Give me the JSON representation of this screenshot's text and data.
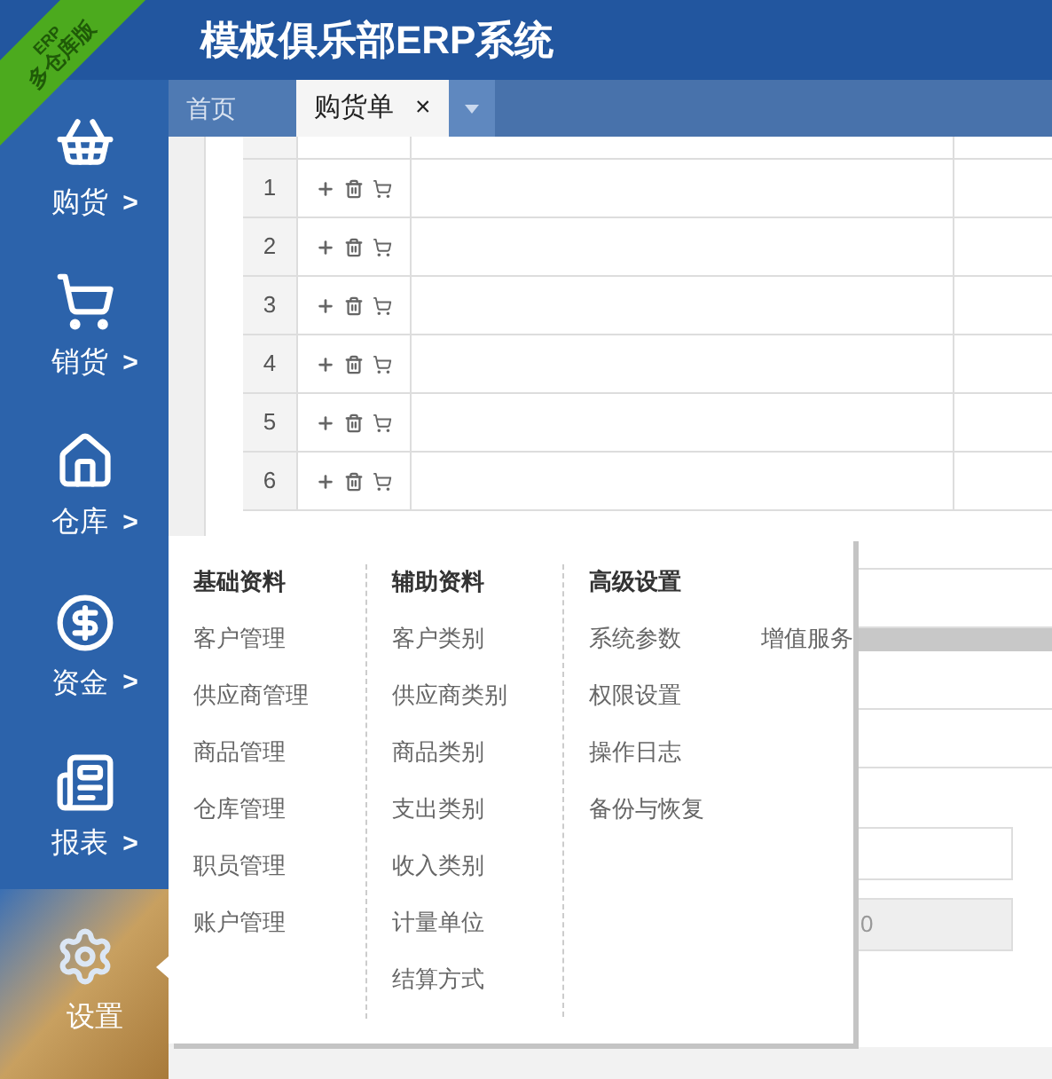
{
  "ribbon": {
    "line_1": "ERP",
    "line_2": "多仓库版"
  },
  "header": {
    "title": "模板俱乐部ERP系统"
  },
  "sidebar": {
    "items": [
      {
        "label": "购货",
        "arrow": ">",
        "selected": false
      },
      {
        "label": "销货",
        "arrow": ">",
        "selected": false
      },
      {
        "label": "仓库",
        "arrow": ">",
        "selected": false
      },
      {
        "label": "资金",
        "arrow": ">",
        "selected": false
      },
      {
        "label": "报表",
        "arrow": ">",
        "selected": false
      },
      {
        "label": "设置",
        "selected": true
      }
    ]
  },
  "tabs": [
    {
      "label": "首页",
      "selected": false
    },
    {
      "label": "购货单",
      "selected": true,
      "close": "×"
    }
  ],
  "table": {
    "rows": [
      {
        "number": "1"
      },
      {
        "number": "2"
      },
      {
        "number": "3"
      },
      {
        "number": "4"
      },
      {
        "number": "5"
      },
      {
        "number": "6"
      }
    ]
  },
  "form": {
    "amount_field": {
      "value": "0",
      "disabled": true
    }
  },
  "settings_menu": {
    "columns": [
      {
        "heading": "基础资料",
        "items": [
          "客户管理",
          "供应商管理",
          "商品管理",
          "仓库管理",
          "职员管理",
          "账户管理"
        ]
      },
      {
        "heading": "辅助资料",
        "items": [
          "客户类别",
          "供应商类别",
          "商品类别",
          "支出类别",
          "收入类别",
          "计量单位",
          "结算方式"
        ]
      },
      {
        "heading": "高级设置",
        "items": [
          "系统参数",
          "权限设置",
          "操作日志",
          "备份与恢复"
        ],
        "extra_items": [
          "增值服务"
        ]
      }
    ]
  }
}
